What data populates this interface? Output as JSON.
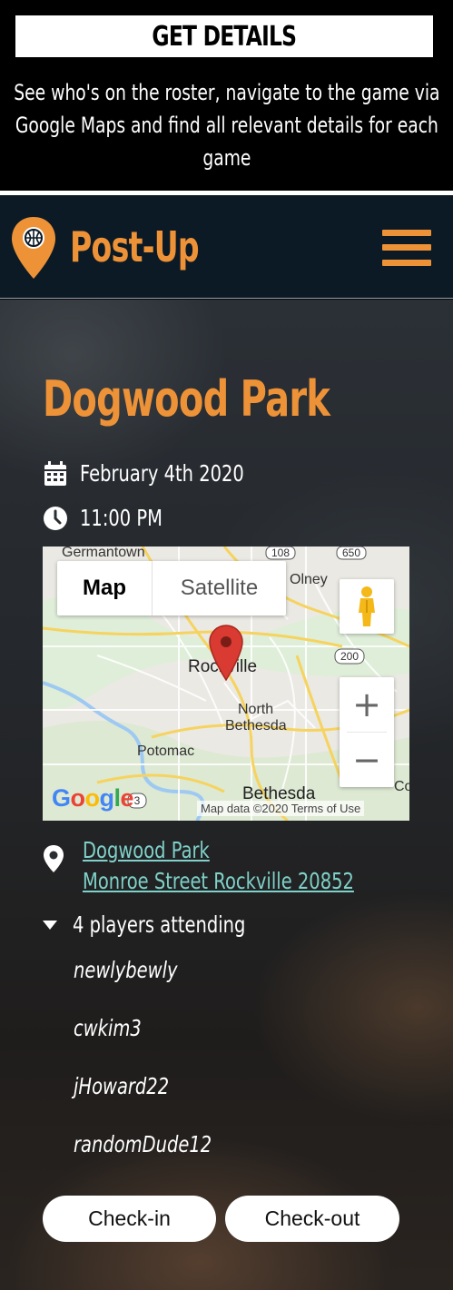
{
  "promo": {
    "title": "GET DETAILS",
    "description": "See who's on the roster, navigate to the game via Google Maps and find all relevant details for each game"
  },
  "app": {
    "brand": "Post-Up",
    "accent_color": "#ee9238",
    "nav_bg": "#0c1a26"
  },
  "game": {
    "title": "Dogwood Park",
    "date": "February 4th 2020",
    "time": "11:00 PM",
    "location_name": "Dogwood Park",
    "address": "Monroe Street Rockville 20852",
    "attending_label": "4 players attending",
    "players": [
      "newlybewly",
      "cwkim3",
      "jHoward22",
      "randomDude12"
    ]
  },
  "map": {
    "tab_map": "Map",
    "tab_satellite": "Satellite",
    "labels": {
      "germantown": "Germantown",
      "olney": "Olney",
      "rockville": "Rockville",
      "north_bethesda_1": "North",
      "north_bethesda_2": "Bethesda",
      "potomac": "Potomac",
      "bethesda": "Bethesda",
      "co": "Co"
    },
    "shields": {
      "r108": "108",
      "r650": "650",
      "r200": "200",
      "r3": "3"
    },
    "google": "Google",
    "attribution": "Map data ©2020   Terms of Use",
    "zoom_in": "+",
    "zoom_out": "−"
  },
  "actions": {
    "check_in": "Check-in",
    "check_out": "Check-out"
  }
}
